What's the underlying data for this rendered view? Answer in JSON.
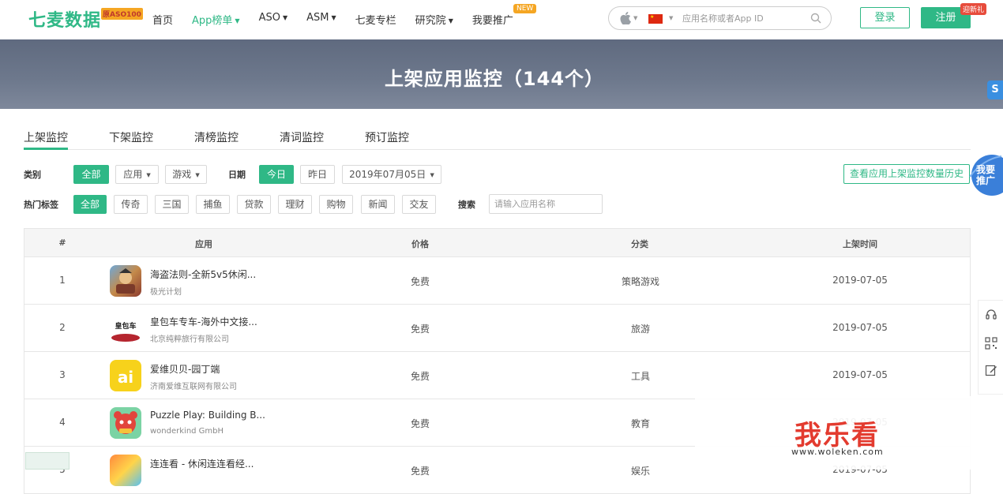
{
  "brand": {
    "logo": "七麦数据",
    "badge": "原ASO100"
  },
  "nav": [
    {
      "label": "首页",
      "dropdown": false,
      "active": false
    },
    {
      "label": "App榜单",
      "dropdown": true,
      "active": true
    },
    {
      "label": "ASO",
      "dropdown": true,
      "active": false
    },
    {
      "label": "ASM",
      "dropdown": true,
      "active": false
    },
    {
      "label": "七麦专栏",
      "dropdown": false,
      "active": false
    },
    {
      "label": "研究院",
      "dropdown": true,
      "active": false
    },
    {
      "label": "我要推广",
      "dropdown": false,
      "active": false
    }
  ],
  "nav_new_badge": "NEW",
  "search": {
    "placeholder": "应用名称或者App ID"
  },
  "auth": {
    "login": "登录",
    "register": "注册",
    "gift_badge": "迎新礼"
  },
  "banner": {
    "title": "上架应用监控（144个）",
    "side_label": "S"
  },
  "tabs": [
    "上架监控",
    "下架监控",
    "清榜监控",
    "清词监控",
    "预订监控"
  ],
  "filters": {
    "category_label": "类别",
    "category_options": [
      "全部",
      "应用",
      "游戏"
    ],
    "date_label": "日期",
    "date_options": [
      "今日",
      "昨日"
    ],
    "date_value": "2019年07月05日",
    "tags_label": "热门标签",
    "tags": [
      "全部",
      "传奇",
      "三国",
      "捕鱼",
      "贷款",
      "理财",
      "购物",
      "新闻",
      "交友"
    ],
    "search_label": "搜索",
    "search_placeholder": "请输入应用名称",
    "history_button": "查看应用上架监控数量历史"
  },
  "table": {
    "headers": [
      "#",
      "应用",
      "价格",
      "分类",
      "上架时间"
    ],
    "rows": [
      {
        "rank": "1",
        "name": "海盗法则-全新5v5休闲...",
        "developer": "极光计划",
        "price": "免费",
        "category": "策略游戏",
        "date": "2019-07-05"
      },
      {
        "rank": "2",
        "name": "皇包车专车-海外中文接...",
        "developer": "北京纯粹旅行有限公司",
        "price": "免费",
        "category": "旅游",
        "date": "2019-07-05",
        "icon_text": "皇包车"
      },
      {
        "rank": "3",
        "name": "爱维贝贝-园丁端",
        "developer": "济南爱维互联网有限公司",
        "price": "免费",
        "category": "工具",
        "date": "2019-07-05",
        "icon_text": "ai"
      },
      {
        "rank": "4",
        "name": "Puzzle Play: Building B...",
        "developer": "wonderkind GmbH",
        "price": "免费",
        "category": "教育",
        "date": "2019-07-05"
      },
      {
        "rank": "5",
        "name": "连连看 - 休闲连连看经...",
        "developer": "",
        "price": "免费",
        "category": "娱乐",
        "date": "2019-07-05"
      }
    ]
  },
  "float": {
    "promo_line1": "我要",
    "promo_line2": "推广"
  },
  "watermark": {
    "text": "我乐看",
    "url": "www.woleken.com"
  },
  "colors": {
    "accent": "#2fb886",
    "banner": "#6b7589",
    "new_badge": "#f5a623",
    "gift_badge": "#e74c3c"
  }
}
